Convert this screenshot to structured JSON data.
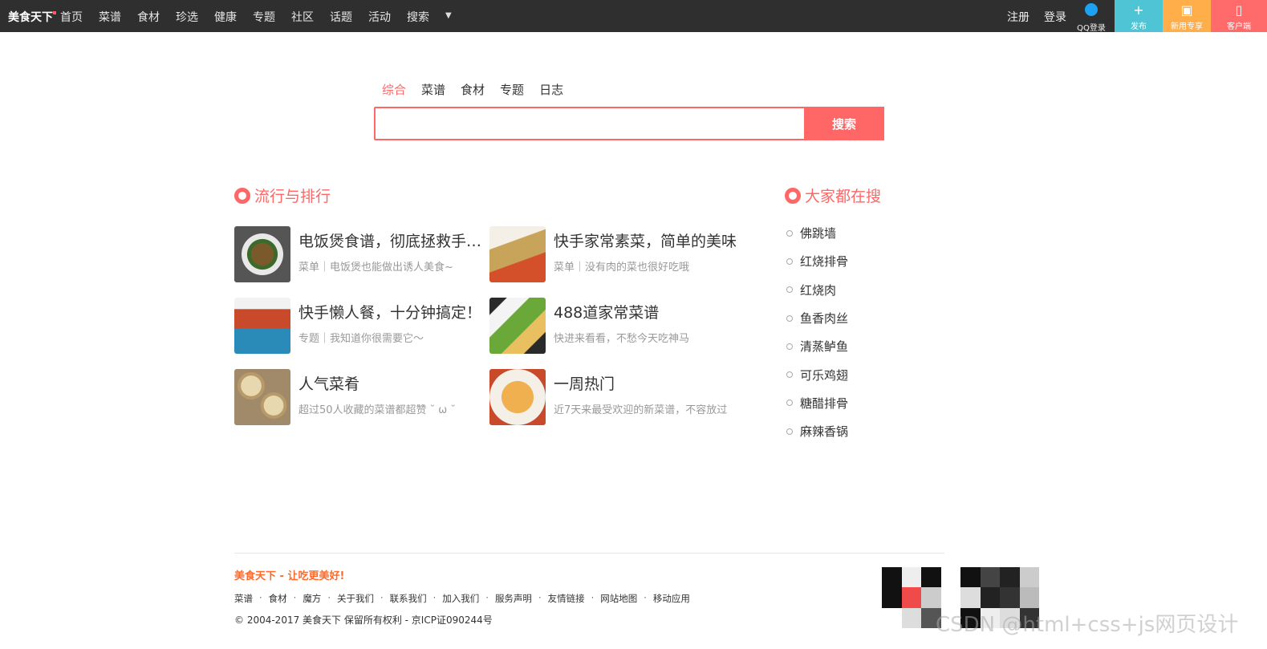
{
  "topbar": {
    "logo": "美食天下",
    "nav": [
      "首页",
      "菜谱",
      "食材",
      "珍选",
      "健康",
      "专题",
      "社区",
      "话题",
      "活动",
      "搜索"
    ],
    "caret_icon": "caret-down-icon",
    "register": "注册",
    "login": "登录",
    "qq_login": "QQ登录",
    "publish": "发布",
    "gift": "新用专享",
    "client": "客户端"
  },
  "search": {
    "tabs": [
      "综合",
      "菜谱",
      "食材",
      "专题",
      "日志"
    ],
    "active_tab": "综合",
    "placeholder": "",
    "button": "搜索"
  },
  "popular": {
    "title": "流行与排行",
    "items": [
      {
        "title": "电饭煲食谱，彻底拯救手残党",
        "desc": "菜单｜电饭煲也能做出诱人美食~"
      },
      {
        "title": "快手家常素菜，简单的美味",
        "desc": "菜单｜没有肉的菜也很好吃哦"
      },
      {
        "title": "快手懒人餐，十分钟搞定！",
        "desc": "专题｜我知道你很需要它～"
      },
      {
        "title": "488道家常菜谱",
        "desc": "快进来看看，不愁今天吃神马"
      },
      {
        "title": "人气菜肴",
        "desc": "超过50人收藏的菜谱都超赞 ˘ ω ˘"
      },
      {
        "title": "一周热门",
        "desc": "近7天来最受欢迎的新菜谱，不容放过"
      }
    ]
  },
  "hot_search": {
    "title": "大家都在搜",
    "items": [
      "佛跳墙",
      "红烧排骨",
      "红烧肉",
      "鱼香肉丝",
      "清蒸鲈鱼",
      "可乐鸡翅",
      "糖醋排骨",
      "麻辣香锅"
    ]
  },
  "footer": {
    "slogan": "美食天下 - 让吃更美好!",
    "links": [
      "菜谱",
      "食材",
      "魔方",
      "关于我们",
      "联系我们",
      "加入我们",
      "服务声明",
      "友情链接",
      "网站地图",
      "移动应用"
    ],
    "copyright": "© 2004-2017 美食天下 保留所有权利 - 京ICP证090244号"
  },
  "watermark": "CSDN @html+css+js网页设计",
  "colors": {
    "accent": "#ff6767",
    "topbar": "#2f2f2f",
    "slogan": "#ff6a2a"
  }
}
